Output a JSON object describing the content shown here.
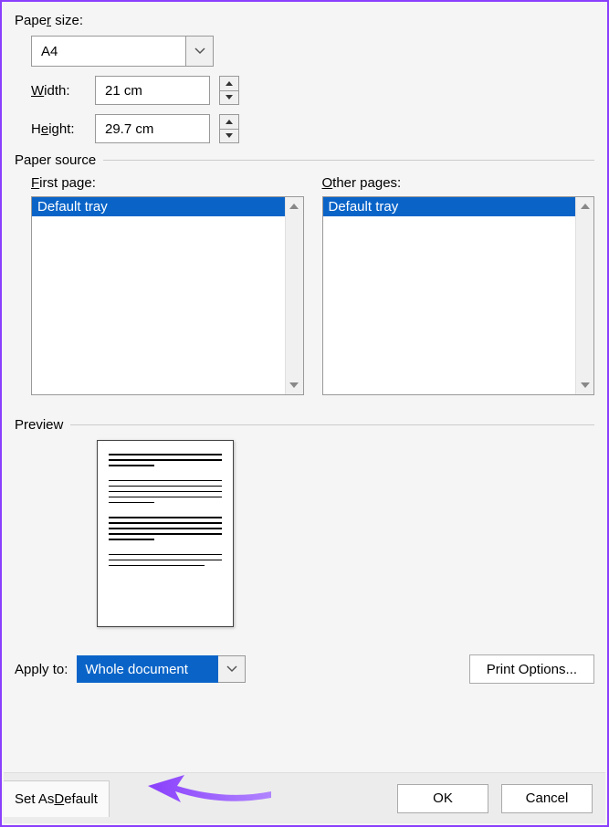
{
  "paper": {
    "size_label": "Paper size:",
    "size_value": "A4",
    "width_label": "Width:",
    "width_value": "21 cm",
    "height_label": "Height:",
    "height_value": "29.7 cm"
  },
  "source": {
    "section": "Paper source",
    "first_label": "First page:",
    "other_label": "Other pages:",
    "first_items": [
      "Default tray"
    ],
    "other_items": [
      "Default tray"
    ],
    "selected": "Default tray"
  },
  "preview": {
    "section": "Preview"
  },
  "apply": {
    "label": "Apply to:",
    "value": "Whole document",
    "print_options": "Print Options..."
  },
  "buttons": {
    "set_default": "Set As Default",
    "ok": "OK",
    "cancel": "Cancel"
  },
  "colors": {
    "accent": "#0a64c8",
    "annotation": "#8a3ffc"
  }
}
